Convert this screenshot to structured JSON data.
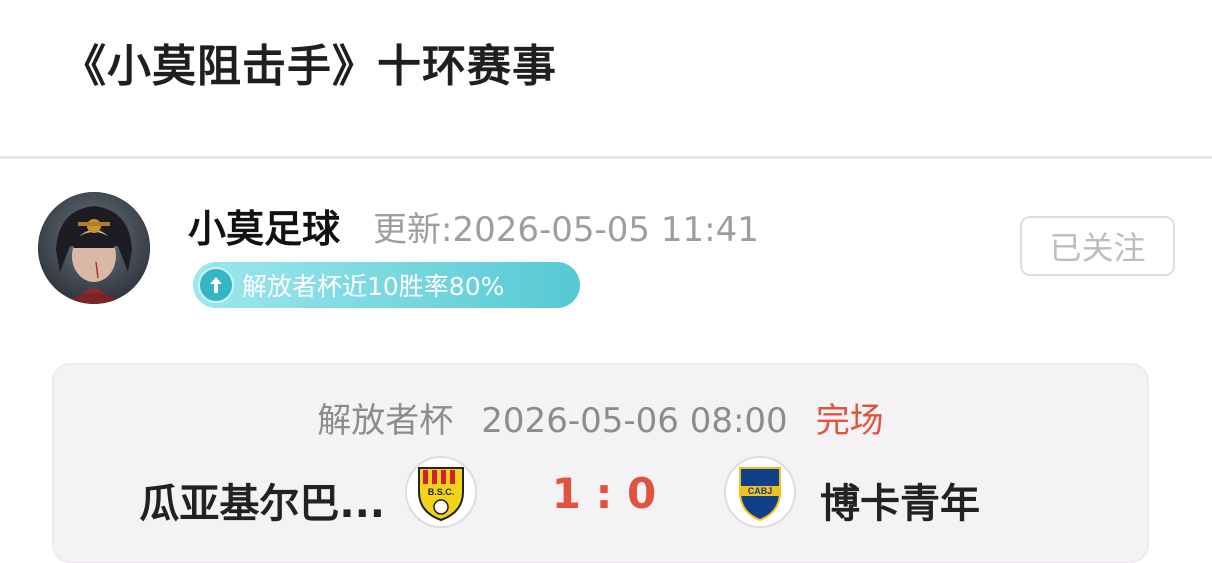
{
  "page": {
    "title": "《小莫阻击手》十环赛事"
  },
  "author": {
    "name": "小莫足球",
    "updated": "更新:2026-05-05 11:41",
    "badge": "解放者杯近10胜率80%",
    "follow_label": "已关注"
  },
  "match": {
    "league": "解放者杯",
    "datetime": "2026-05-06 08:00",
    "status": "完场",
    "home_team": "瓜亚基尔巴...",
    "away_team": "博卡青年",
    "score": "1 : 0",
    "home_logo_text": "B.S.C.",
    "away_logo_text": "CABJ"
  },
  "colors": {
    "accent_red": "#e0533f",
    "badge_teal": "#56c9d3",
    "muted_gray": "#9e9e9e"
  },
  "icons": {
    "badge": "up-arrow-icon",
    "avatar": "avatar-image"
  }
}
